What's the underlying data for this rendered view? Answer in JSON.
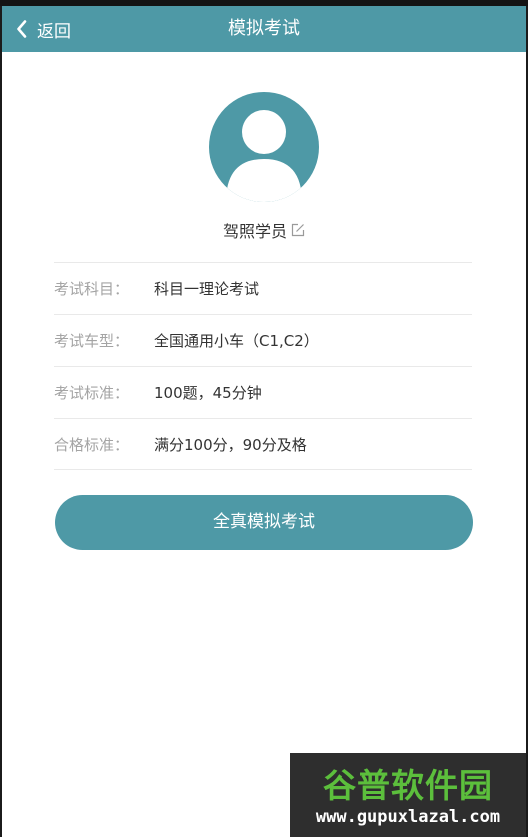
{
  "header": {
    "back_label": "返回",
    "title": "模拟考试"
  },
  "profile": {
    "name": "驾照学员"
  },
  "info": [
    {
      "label": "考试科目：",
      "value": "科目一理论考试"
    },
    {
      "label": "考试车型：",
      "value": "全国通用小车（C1,C2）"
    },
    {
      "label": "考试标准：",
      "value": "100题，45分钟"
    },
    {
      "label": "合格标准：",
      "value": "满分100分，90分及格"
    }
  ],
  "action": {
    "start_label": "全真模拟考试"
  },
  "watermark": {
    "title": "谷普软件园",
    "url": "www.gupuxlazal.com"
  },
  "colors": {
    "accent": "#4e99a6",
    "label_gray": "#a4a4a4",
    "text_dark": "#333333"
  }
}
